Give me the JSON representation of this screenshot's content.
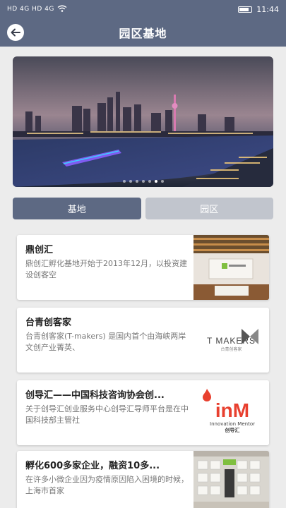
{
  "status_bar": {
    "carrier_left": "HD 4G HD 4G",
    "time": "11:44"
  },
  "header": {
    "title": "园区基地",
    "back_icon": "back-arrow-icon"
  },
  "banner": {
    "dot_count": 7,
    "active_dot": 5
  },
  "tabs": [
    {
      "label": "基地",
      "active": true
    },
    {
      "label": "园区",
      "active": false
    }
  ],
  "cards": [
    {
      "title": "鼎创汇",
      "desc": "鼎创汇孵化基地开始于2013年12月，以投资建设创客空"
    },
    {
      "title": "台青创客家",
      "desc": "台青创客家(T-makers) 是国内首个由海峡两岸文创产业菁英、"
    },
    {
      "title": "创导汇——中国科技咨询协会创...",
      "desc": "关于创导汇创业服务中心创导汇导师平台是在中国科技部主管社"
    },
    {
      "title": "孵化600多家企业，融资10多...",
      "desc": "在许多小微企业因为疫情原因陷入困境的时候，上海市首家"
    }
  ],
  "thumb_logos": {
    "tmakers_main": "T MAKERS",
    "tmakers_sub": "台青创客家",
    "inm_main": "inM",
    "inm_sub1": "Innovation Mentor",
    "inm_sub2": "创导汇"
  },
  "colors": {
    "header": "#5d6983",
    "tab_inactive": "#c1c5cd",
    "inm_red": "#e8402f"
  }
}
